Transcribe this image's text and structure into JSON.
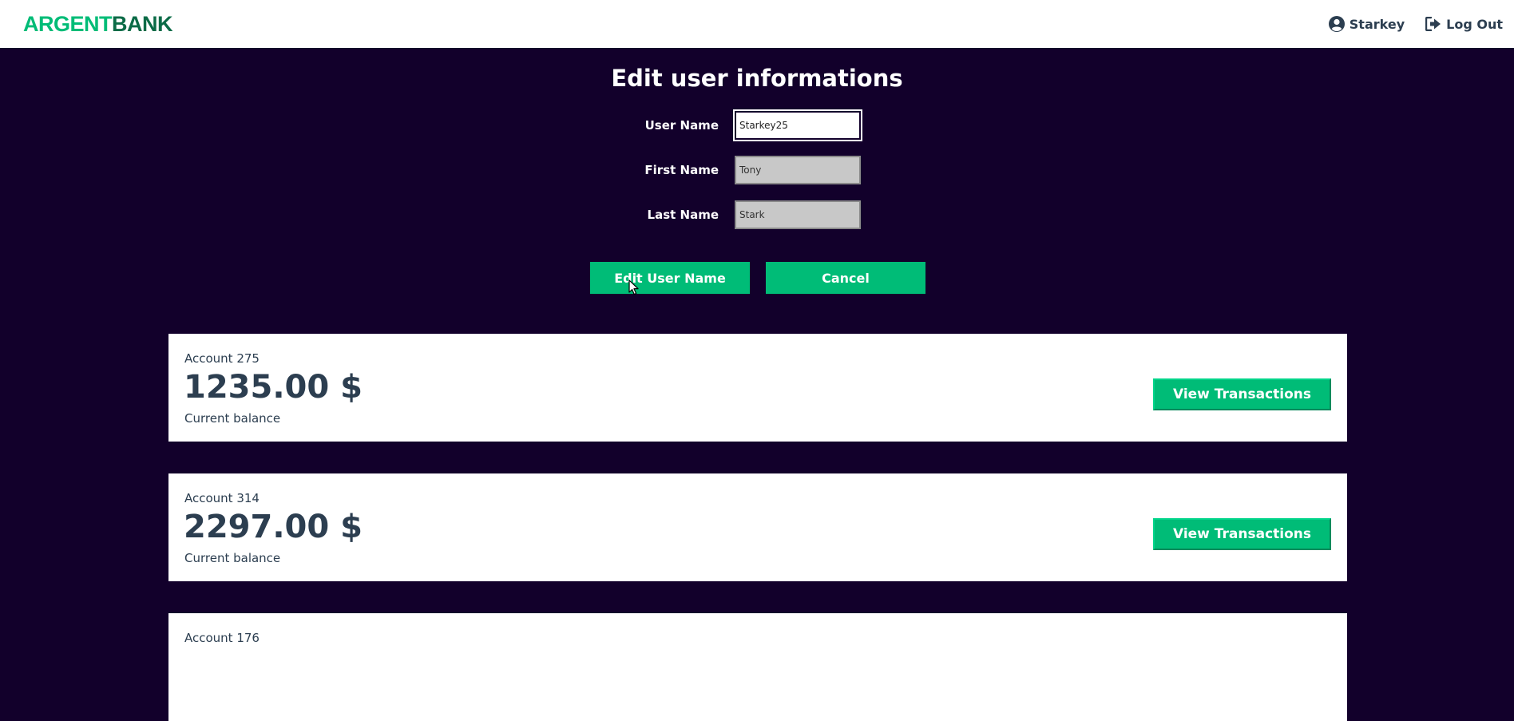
{
  "header": {
    "logo_part1": "ARGENT",
    "logo_part2": "BANK",
    "user_name": "Starkey",
    "logout_label": "Log Out",
    "user_icon": "user-circle-icon",
    "logout_icon": "sign-out-icon"
  },
  "edit_form": {
    "title": "Edit user informations",
    "fields": [
      {
        "label": "User Name",
        "value": "Starkey25",
        "editable": true
      },
      {
        "label": "First Name",
        "value": "Tony",
        "editable": false
      },
      {
        "label": "Last Name",
        "value": "Stark",
        "editable": false
      }
    ],
    "submit_label": "Edit User Name",
    "cancel_label": "Cancel"
  },
  "accounts": [
    {
      "title": "Account 275",
      "amount": "1235.00 $",
      "description": "Current balance",
      "button_label": "View Transactions"
    },
    {
      "title": "Account 314",
      "amount": "2297.00 $",
      "description": "Current balance",
      "button_label": "View Transactions"
    },
    {
      "title": "Account 176"
    }
  ],
  "colors": {
    "background": "#12002b",
    "accent": "#00bc77",
    "text_dark": "#2c3e50"
  }
}
